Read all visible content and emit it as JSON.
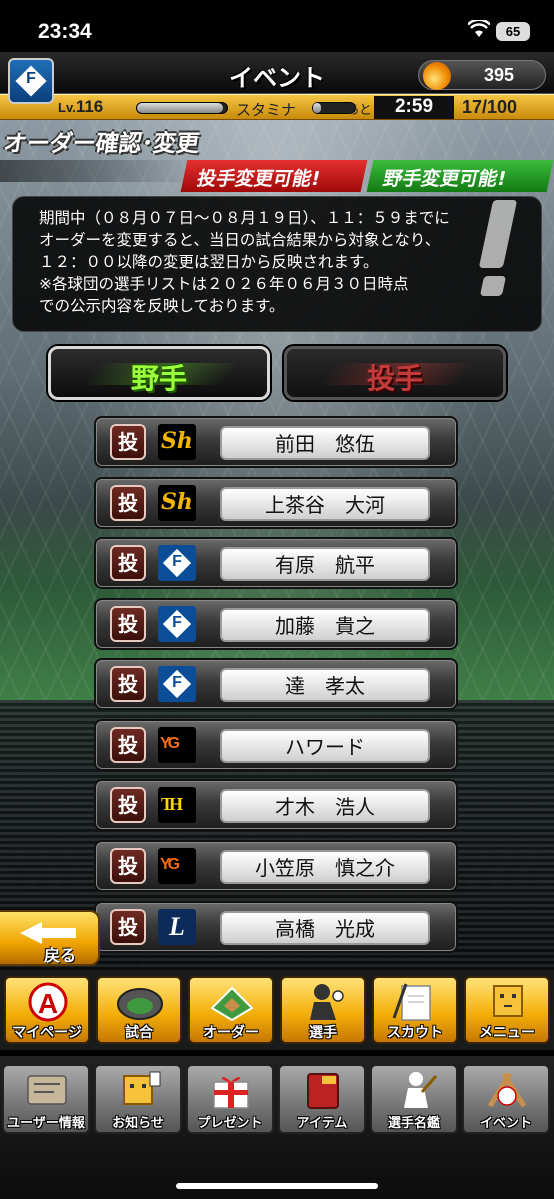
{
  "status_bar": {
    "time": "23:34",
    "battery": "65"
  },
  "header": {
    "title": "イベント",
    "coins": "395",
    "team_badge": "F"
  },
  "level_bar": {
    "level_prefix": "Lv.",
    "level": "116",
    "exp_fill": 0.95,
    "stamina_label": "スタミナ",
    "stamina_fill": 0.2,
    "remaining_label": "あと",
    "timer": "2:59",
    "stamina_value": "17/100"
  },
  "order": {
    "title": "オーダー確認･変更",
    "flag_pitcher": "投手変更可能!",
    "flag_fielder": "野手変更可能!",
    "notice_lines": [
      "期間中（０８月０７日〜０８月１９日）、１１：５９までに",
      "オーダーを変更すると、当日の試合結果から対象となり、",
      "１２：００以降の変更は翌日から反映されます。",
      "※各球団の選手リストは２０２６年０６月３０日時点",
      "での公示内容を反映しております。"
    ]
  },
  "tabs": {
    "fielder": "野手",
    "pitcher": "投手"
  },
  "players": [
    {
      "pos": "投",
      "team": "hawks",
      "name": "前田　悠伍"
    },
    {
      "pos": "投",
      "team": "hawks",
      "name": "上茶谷　大河"
    },
    {
      "pos": "投",
      "team": "fighters",
      "name": "有原　航平"
    },
    {
      "pos": "投",
      "team": "fighters",
      "name": "加藤　貴之"
    },
    {
      "pos": "投",
      "team": "fighters",
      "name": "達　孝太"
    },
    {
      "pos": "投",
      "team": "giants",
      "name": "ハワード"
    },
    {
      "pos": "投",
      "team": "tigers",
      "name": "才木　浩人"
    },
    {
      "pos": "投",
      "team": "giants",
      "name": "小笠原　慎之介"
    },
    {
      "pos": "投",
      "team": "lions",
      "name": "高橋　光成"
    }
  ],
  "back_label": "戻る",
  "main_nav": [
    {
      "label": "マイページ",
      "icon": "mypage-icon"
    },
    {
      "label": "試合",
      "icon": "stadium-icon"
    },
    {
      "label": "オーダー",
      "icon": "field-icon"
    },
    {
      "label": "選手",
      "icon": "player-icon"
    },
    {
      "label": "スカウト",
      "icon": "scout-icon"
    },
    {
      "label": "メニュー",
      "icon": "menu-icon"
    }
  ],
  "sub_nav": [
    {
      "label": "ユーザー情報",
      "icon": "user-info-icon"
    },
    {
      "label": "お知らせ",
      "icon": "notice-icon"
    },
    {
      "label": "プレゼント",
      "icon": "gift-icon"
    },
    {
      "label": "アイテム",
      "icon": "item-icon"
    },
    {
      "label": "選手名鑑",
      "icon": "directory-icon"
    },
    {
      "label": "イベント",
      "icon": "event-icon"
    }
  ],
  "colors": {
    "accent_gold": "#f4b00a",
    "pitcher_red": "#c43b3b",
    "fielder_green": "#9cff3c"
  }
}
